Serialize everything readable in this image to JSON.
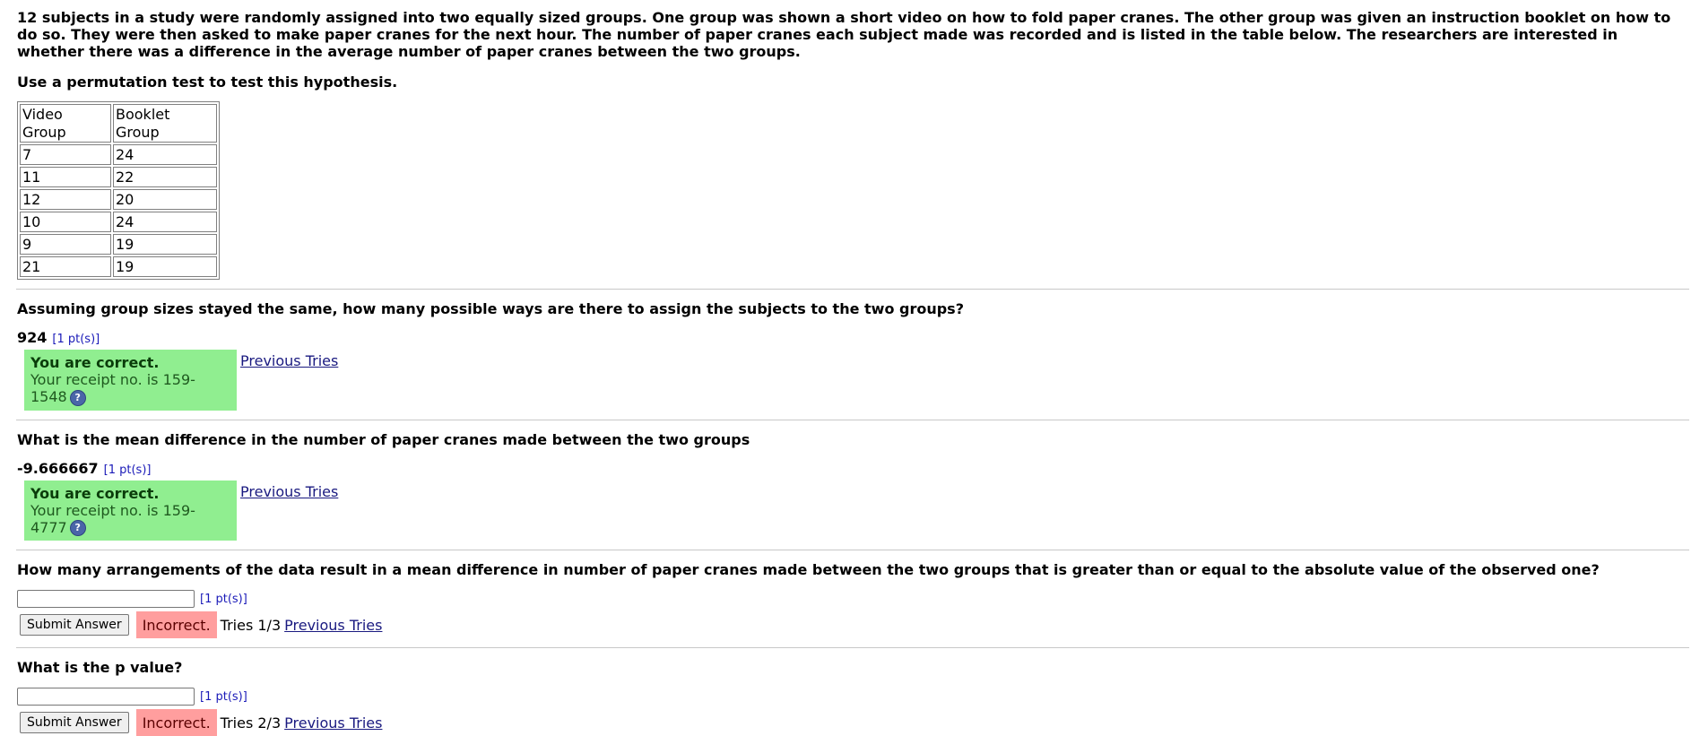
{
  "intro": "12 subjects in a study were randomly assigned into two equally sized groups. One group was shown a short video on how to fold paper cranes. The other group was given an instruction booklet on how to do so. They were then asked to make paper cranes for the next hour. The number of paper cranes each subject made was recorded and is listed in the table below. The researchers are interested in whether there was a difference in the average number of paper cranes between the two groups.",
  "instruction": "Use a permutation test to test this hypothesis.",
  "table": {
    "headers": [
      "Video Group",
      "Booklet Group"
    ],
    "rows": [
      [
        "7",
        "24"
      ],
      [
        "11",
        "22"
      ],
      [
        "12",
        "20"
      ],
      [
        "10",
        "24"
      ],
      [
        "9",
        "19"
      ],
      [
        "21",
        "19"
      ]
    ]
  },
  "q1": {
    "question": "Assuming group sizes stayed the same, how many possible ways are there to assign the subjects to the two groups?",
    "answer": "924",
    "points": "[1 pt(s)]",
    "feedback_title": "You are correct.",
    "receipt": "Your receipt no. is 159-1548",
    "help_icon": "?",
    "previous_tries": "Previous Tries"
  },
  "q2": {
    "question": "What is the mean difference in the number of paper cranes made between the two groups",
    "answer": "-9.666667",
    "points": "[1 pt(s)]",
    "feedback_title": "You are correct.",
    "receipt": "Your receipt no. is 159-4777",
    "help_icon": "?",
    "previous_tries": "Previous Tries"
  },
  "q3": {
    "question": "How many arrangements of the data result in a mean difference in number of paper cranes made between the two groups that is greater than or equal to the absolute value of the observed one?",
    "input_value": "",
    "points": "[1 pt(s)]",
    "submit_label": "Submit Answer",
    "status": "Incorrect.",
    "tries": "Tries 1/3",
    "previous_tries": "Previous Tries"
  },
  "q4": {
    "question": "What is the p value?",
    "input_value": "",
    "points": "[1 pt(s)]",
    "submit_label": "Submit Answer",
    "status": "Incorrect.",
    "tries": "Tries 2/3",
    "previous_tries": "Previous Tries"
  },
  "colors": {
    "correct_bg": "#90ee90",
    "incorrect_bg": "#ff9e9e",
    "link": "#1a1a80",
    "points": "#1a1ab8"
  }
}
